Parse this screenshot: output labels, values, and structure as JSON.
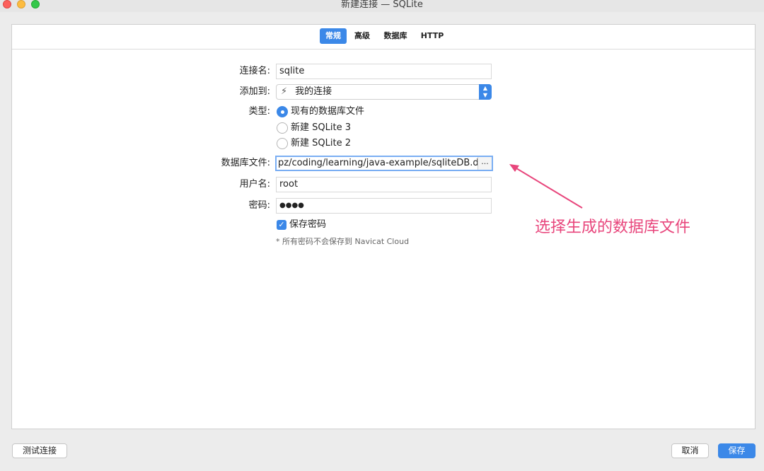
{
  "window": {
    "title": "新建连接 — SQLite"
  },
  "tabs": [
    {
      "label": "常规",
      "active": true
    },
    {
      "label": "高级",
      "active": false
    },
    {
      "label": "数据库",
      "active": false
    },
    {
      "label": "HTTP",
      "active": false
    }
  ],
  "form": {
    "connection_name": {
      "label": "连接名:",
      "value": "sqlite"
    },
    "add_to": {
      "label": "添加到:",
      "value": "我的连接",
      "icon": "plug-icon"
    },
    "type": {
      "label": "类型:",
      "options": [
        {
          "label": "现有的数据库文件",
          "checked": true
        },
        {
          "label": "新建 SQLite 3",
          "checked": false
        },
        {
          "label": "新建 SQLite 2",
          "checked": false
        }
      ]
    },
    "db_file": {
      "label": "数据库文件:",
      "value": "pz/coding/learning/java-example/sqliteDB.db",
      "browse_label": "..."
    },
    "username": {
      "label": "用户名:",
      "value": "root"
    },
    "password": {
      "label": "密码:",
      "value": "●●●●"
    },
    "save_password": {
      "label": "保存密码",
      "checked": true,
      "check_glyph": "✓"
    },
    "note": "* 所有密码不会保存到 Navicat Cloud"
  },
  "annotation": {
    "text": "选择生成的数据库文件",
    "color": "#e8467c"
  },
  "footer": {
    "test_label": "测试连接",
    "cancel_label": "取消",
    "save_label": "保存"
  },
  "colors": {
    "accent": "#3b88e8"
  }
}
